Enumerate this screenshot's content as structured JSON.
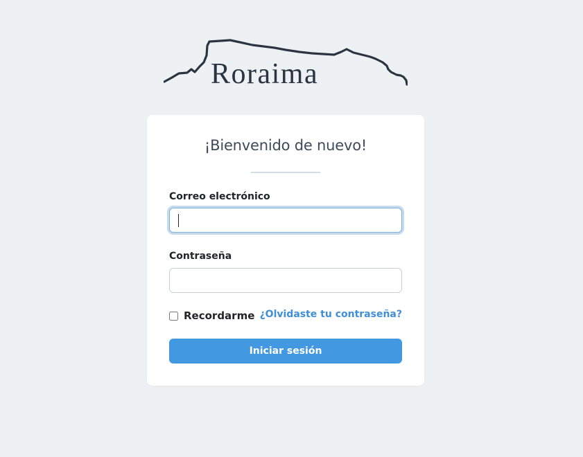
{
  "brand": {
    "name": "Roraima",
    "color": "#2b3440"
  },
  "card": {
    "title": "¡Bienvenido de nuevo!"
  },
  "form": {
    "email_label": "Correo electrónico",
    "email_value": "",
    "password_label": "Contraseña",
    "password_value": "",
    "remember_label": "Recordarme",
    "remember_checked": false,
    "forgot_link": "¿Olvidaste tu contraseña?",
    "submit_label": "Iniciar sesión"
  },
  "colors": {
    "background": "#edf1f4",
    "card": "#ffffff",
    "accent": "#4299e1",
    "link": "#3f8fd8"
  }
}
